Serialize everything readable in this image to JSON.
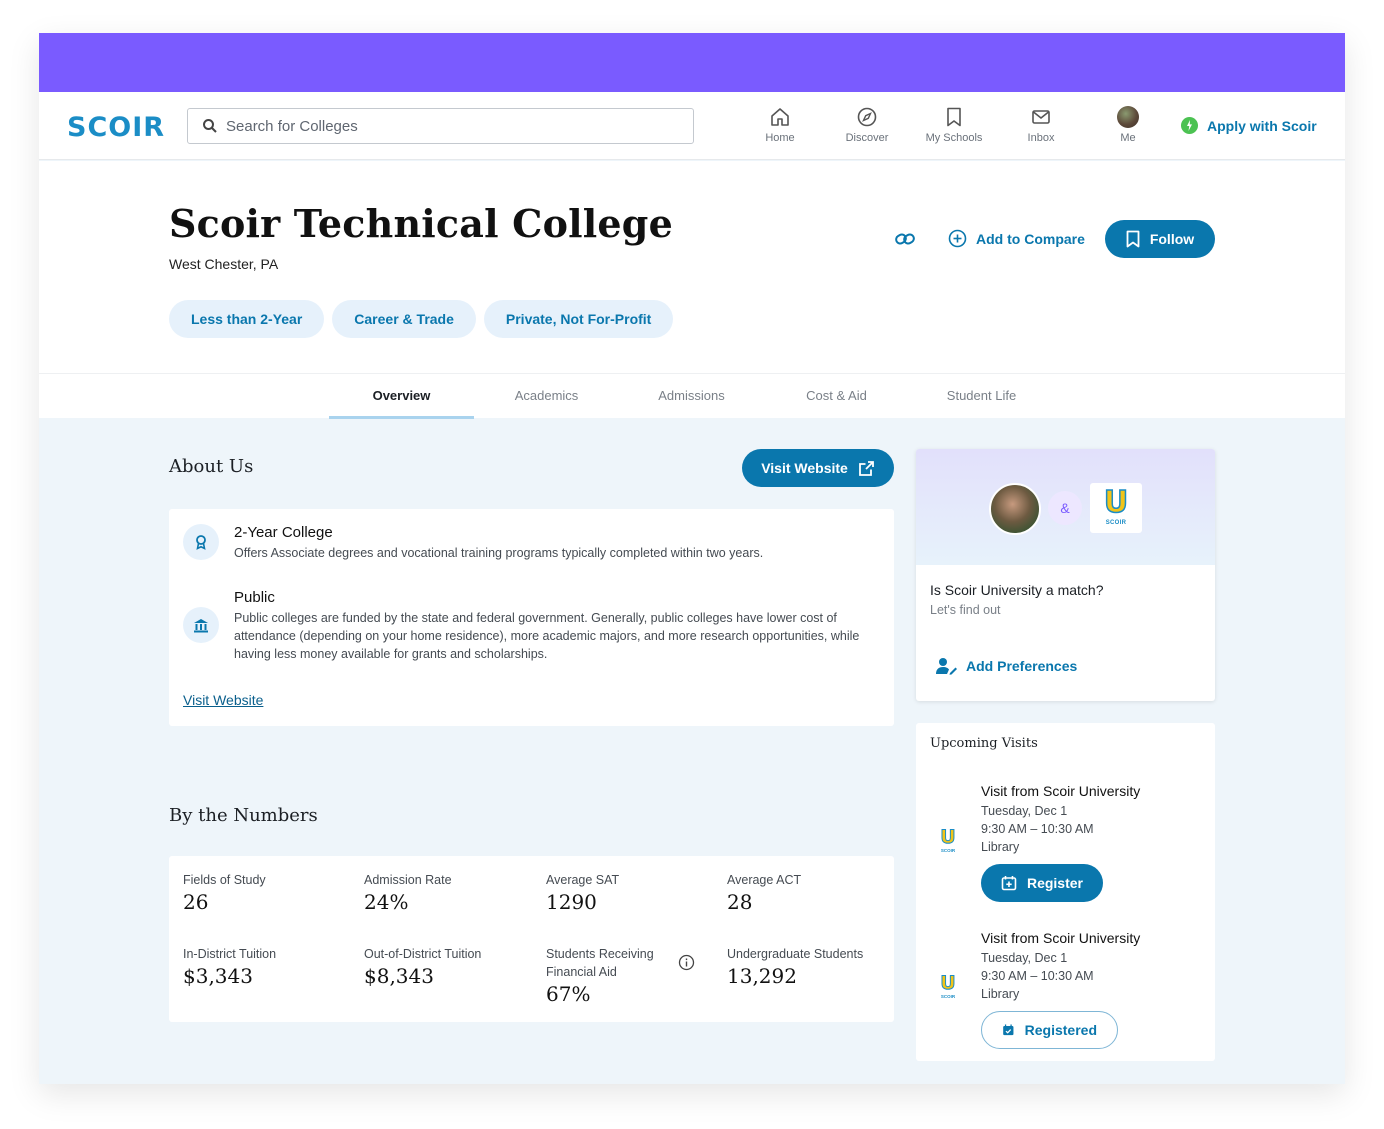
{
  "nav": {
    "logo": "SCOIR",
    "search_placeholder": "Search for Colleges",
    "items": [
      {
        "label": "Home",
        "icon": "home-icon"
      },
      {
        "label": "Discover",
        "icon": "compass-icon"
      },
      {
        "label": "My Schools",
        "icon": "bookmark-icon"
      },
      {
        "label": "Inbox",
        "icon": "mail-icon"
      },
      {
        "label": "Me",
        "icon": "avatar"
      }
    ],
    "apply_label": "Apply with Scoir"
  },
  "college": {
    "name": "Scoir Technical College",
    "location": "West Chester, PA",
    "tags": [
      "Less than 2-Year",
      "Career & Trade",
      "Private, Not For-Profit"
    ],
    "add_compare_label": "Add to Compare",
    "follow_label": "Follow"
  },
  "tabs": [
    "Overview",
    "Academics",
    "Admissions",
    "Cost & Aid",
    "Student Life"
  ],
  "about": {
    "heading": "About Us",
    "visit_button_label": "Visit Website",
    "features": [
      {
        "title": "2-Year College",
        "description": "Offers Associate degrees and vocational training programs typically completed within two years.",
        "icon": "award-icon"
      },
      {
        "title": "Public",
        "description": "Public colleges are funded by the state and federal government. Generally, public colleges have lower cost of attendance (depending on your home residence), more academic majors, and more research opportunities, while having less money available for grants and scholarships.",
        "icon": "institution-icon"
      }
    ],
    "visit_link_label": "Visit Website"
  },
  "numbers": {
    "heading": "By the Numbers",
    "stats": [
      {
        "label": "Fields of Study",
        "value": "26"
      },
      {
        "label": "Admission Rate",
        "value": "24%"
      },
      {
        "label": "Average SAT",
        "value": "1290"
      },
      {
        "label": "Average ACT",
        "value": "28"
      },
      {
        "label": "In-District Tuition",
        "value": "$3,343"
      },
      {
        "label": "Out-of-District Tuition",
        "value": "$8,343"
      },
      {
        "label": "Students Receiving Financial Aid",
        "value": "67%"
      },
      {
        "label": "Undergraduate Students",
        "value": "13,292"
      }
    ]
  },
  "match": {
    "amp": "&",
    "logo_letter": "U",
    "logo_word": "SCOIR",
    "question": "Is Scoir University a match?",
    "subtitle": "Let's find out",
    "prefs_label": "Add Preferences"
  },
  "visits": {
    "heading": "Upcoming Visits",
    "items": [
      {
        "title": "Visit from Scoir University",
        "date": "Tuesday, Dec 1",
        "time": "9:30 AM – 10:30 AM",
        "place": "Library",
        "button": "Register",
        "state": "register"
      },
      {
        "title": "Visit from Scoir University",
        "date": "Tuesday, Dec 1",
        "time": "9:30 AM – 10:30 AM",
        "place": "Library",
        "button": "Registered",
        "state": "registered"
      }
    ]
  },
  "colors": {
    "purple_bar": "#7a5bff",
    "primary": "#0a77ad",
    "chip_bg": "#e6f1fb",
    "page_bg": "#eef5fa"
  }
}
